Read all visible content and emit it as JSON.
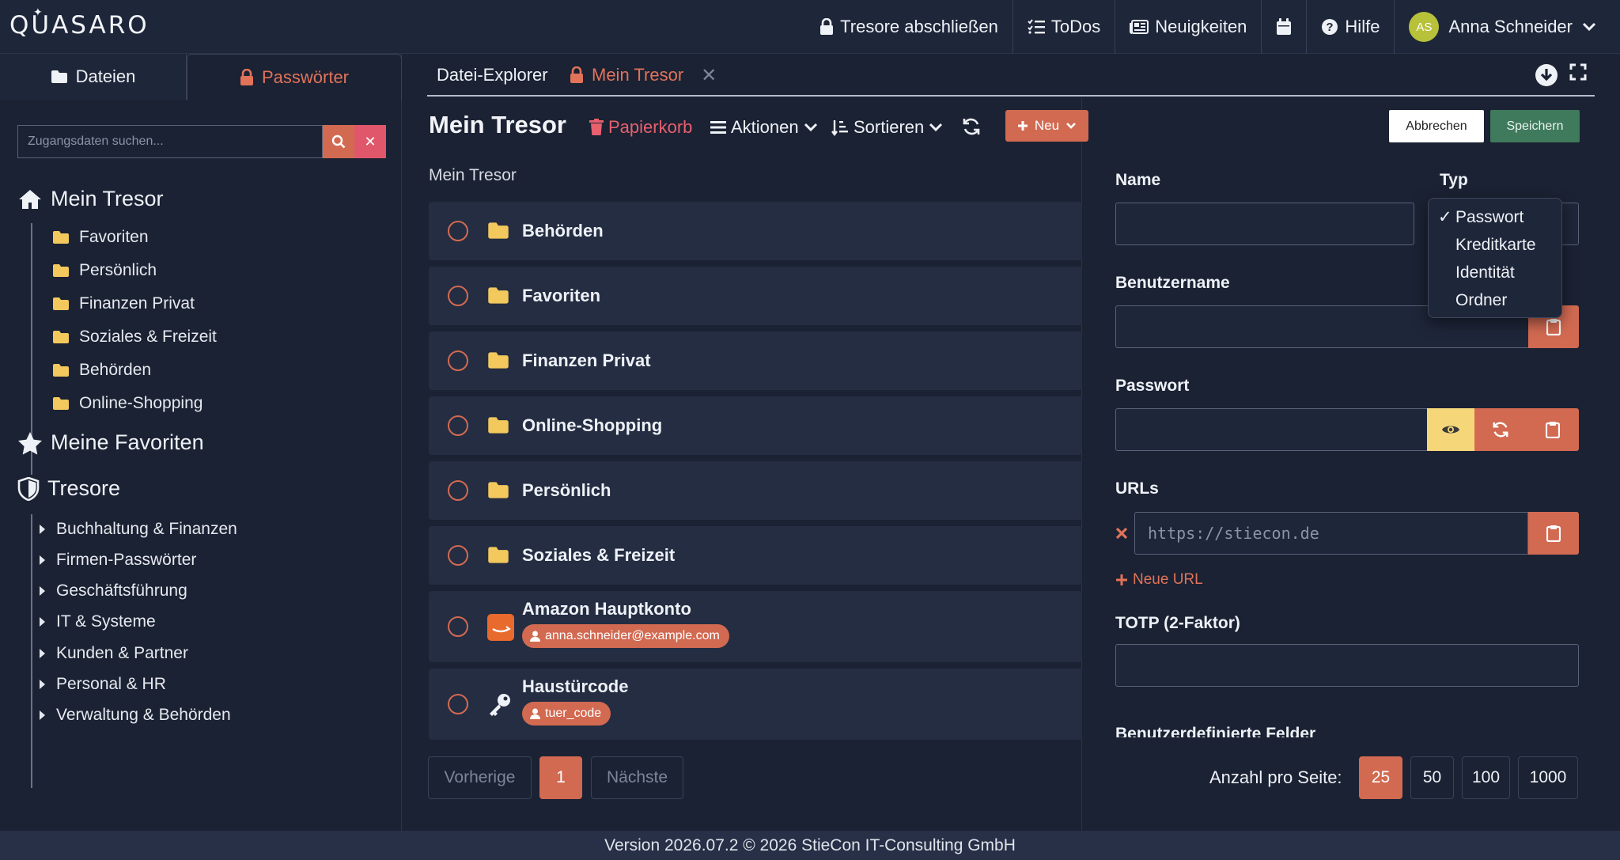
{
  "app": {
    "logo": "QUASARO"
  },
  "topnav": {
    "lock_vaults": "Tresore abschließen",
    "todos": "ToDos",
    "news": "Neuigkeiten",
    "help": "Hilfe",
    "avatar_initials": "AS",
    "user_name": "Anna Schneider"
  },
  "sidebar": {
    "tab_files": "Dateien",
    "tab_passwords": "Passwörter",
    "search_placeholder": "Zugangsdaten suchen...",
    "my_vault": "Mein Tresor",
    "folders": [
      "Favoriten",
      "Persönlich",
      "Finanzen Privat",
      "Soziales & Freizeit",
      "Behörden",
      "Online-Shopping"
    ],
    "my_favorites": "Meine Favoriten",
    "vaults_heading": "Tresore",
    "vaults": [
      "Buchhaltung & Finanzen",
      "Firmen-Passwörter",
      "Geschäftsführung",
      "IT & Systeme",
      "Kunden & Partner",
      "Personal & HR",
      "Verwaltung & Behörden"
    ]
  },
  "main_tabs": {
    "explorer": "Datei-Explorer",
    "vault": "Mein Tresor"
  },
  "content": {
    "title": "Mein Tresor",
    "trash": "Papierkorb",
    "actions": "Aktionen",
    "sort": "Sortieren",
    "new": "Neu",
    "breadcrumb": "Mein Tresor",
    "folder_rows": [
      "Behörden",
      "Favoriten",
      "Finanzen Privat",
      "Online-Shopping",
      "Persönlich",
      "Soziales & Freizeit"
    ],
    "entries": [
      {
        "name": "Amazon Hauptkonto",
        "user": "anna.schneider@example.com"
      },
      {
        "name": "Haustürcode",
        "user": "tuer_code"
      }
    ],
    "pager": {
      "prev": "Vorherige",
      "current": "1",
      "next": "Nächste"
    }
  },
  "form": {
    "cancel": "Abbrechen",
    "save": "Speichern",
    "name_label": "Name",
    "type_label": "Typ",
    "username_label": "Benutzername",
    "password_label": "Passwort",
    "urls_label": "URLs",
    "url_placeholder": "https://stiecon.de",
    "new_url": "Neue URL",
    "totp_label": "TOTP (2-Faktor)",
    "custom_fields_label": "Benutzerdefinierte Felder"
  },
  "type_dropdown": {
    "selected": "Passwort",
    "options": [
      "Passwort",
      "Kreditkarte",
      "Identität",
      "Ordner"
    ]
  },
  "per_page": {
    "label": "Anzahl pro Seite:",
    "options": [
      "25",
      "50",
      "100",
      "1000"
    ],
    "active": "25"
  },
  "footer": {
    "text": "Version 2026.07.2 © 2026 StieCon IT-Consulting GmbH"
  },
  "colors": {
    "accent": "#d26a52",
    "danger": "#e8606e",
    "folder": "#f3c85c",
    "save": "#3f7a5c",
    "background": "#1b2233"
  }
}
